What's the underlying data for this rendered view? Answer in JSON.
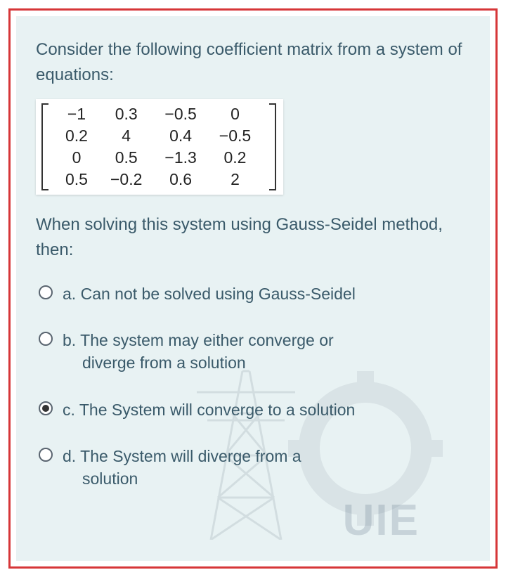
{
  "question": {
    "intro": "Consider the following coefficient matrix from a system of equations:",
    "after": "When solving this system using Gauss-Seidel method, then:"
  },
  "matrix": {
    "rows": [
      [
        "−1",
        "0.3",
        "−0.5",
        "0"
      ],
      [
        "0.2",
        "4",
        "0.4",
        "−0.5"
      ],
      [
        "0",
        "0.5",
        "−1.3",
        "0.2"
      ],
      [
        "0.5",
        "−0.2",
        "0.6",
        "2"
      ]
    ]
  },
  "options": {
    "a": {
      "letter": "a.",
      "text": "Can not be solved using Gauss-Seidel"
    },
    "b": {
      "letter": "b.",
      "line1": "The system may either converge or",
      "line2": "diverge from a solution"
    },
    "c": {
      "letter": "c.",
      "text": "The System will converge to a solution"
    },
    "d": {
      "letter": "d.",
      "line1": "The System will diverge from a",
      "line2": "solution"
    }
  },
  "watermark_text": "UIE"
}
